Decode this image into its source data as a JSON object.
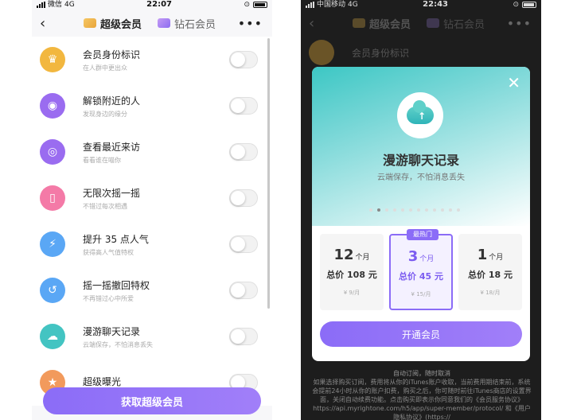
{
  "left": {
    "status": {
      "carrier": "微信",
      "network": "4G",
      "time": "22:07"
    },
    "nav": {
      "back": "‹",
      "tab_active": "超级会员",
      "tab_other": "钻石会员",
      "more": "•••"
    },
    "items": [
      {
        "title": "会员身份标识",
        "sub": "在人群中更出众",
        "icon": "crown-icon",
        "glyph": "♛",
        "color": "#f2b73f"
      },
      {
        "title": "解锁附近的人",
        "sub": "发现身边的缘分",
        "icon": "location-pin-icon",
        "glyph": "◉",
        "color": "#9a6cf0"
      },
      {
        "title": "查看最近来访",
        "sub": "看看谁在喵你",
        "icon": "eye-icon",
        "glyph": "◎",
        "color": "#9a6cf0"
      },
      {
        "title": "无限次摇一摇",
        "sub": "不错过每次相遇",
        "icon": "phone-shake-icon",
        "glyph": "▯",
        "color": "#f47aa7"
      },
      {
        "title": "提升 35 点人气",
        "sub": "获得高人气值特权",
        "icon": "lightning-icon",
        "glyph": "⚡",
        "color": "#5aa7f5"
      },
      {
        "title": "摇一摇撤回特权",
        "sub": "不再错过心中所爱",
        "icon": "undo-icon",
        "glyph": "↺",
        "color": "#5aa7f5"
      },
      {
        "title": "漫游聊天记录",
        "sub": "云端保存，不怕消息丢失",
        "icon": "cloud-upload-icon",
        "glyph": "☁",
        "color": "#43c4c2"
      },
      {
        "title": "超级曝光",
        "sub": "",
        "icon": "exposure-icon",
        "glyph": "★",
        "color": "#f29a5c"
      }
    ],
    "cta": "获取超级会员"
  },
  "right": {
    "status": {
      "carrier": "中国移动",
      "network": "4G",
      "time": "22:43"
    },
    "nav": {
      "back": "‹",
      "tab_active": "超级会员",
      "tab_other": "钻石会员",
      "more": "•••"
    },
    "bg_item": "会员身份标识",
    "modal": {
      "title": "漫游聊天记录",
      "subtitle": "云端保存，不怕消息丢失",
      "close": "✕",
      "hot_badge": "最热门",
      "plans": [
        {
          "months": "12",
          "unit": "个月",
          "total": "总价 108 元",
          "per": "¥ 9/月"
        },
        {
          "months": "3",
          "unit": "个月",
          "total": "总价 45 元",
          "per": "¥ 15/月"
        },
        {
          "months": "1",
          "unit": "个月",
          "total": "总价 18 元",
          "per": "¥ 18/月"
        }
      ],
      "open_button": "开通会员"
    },
    "disclaimer": {
      "line1": "自动订阅，随时取消",
      "body": "如果选择购买订阅，费用将从你的iTunes账户收取，当前费用期结束前，系统会提前24小时从你的账户扣费，购买之后，你可随时前往iTunes商店的设置界面，关闭自动续费功能。点击购买即表示你同意我们的《会员服务协议》https://api.myrightone.com/h5/app/super-member/protocol/ 和《用户隐私协议》(https://"
    }
  }
}
